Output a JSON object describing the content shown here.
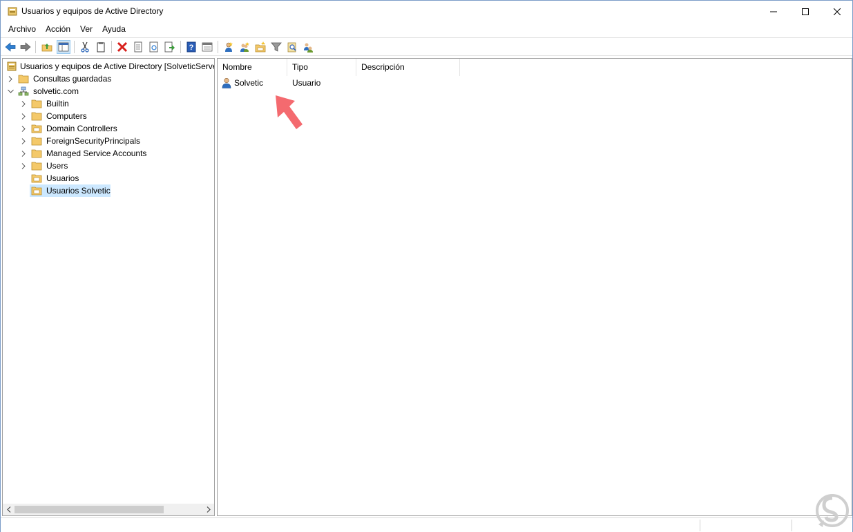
{
  "window": {
    "title": "Usuarios y equipos de Active Directory"
  },
  "menu": {
    "items": [
      "Archivo",
      "Acción",
      "Ver",
      "Ayuda"
    ]
  },
  "toolbar": {
    "icons": [
      "back-icon",
      "forward-icon",
      "up-folder-icon",
      "show-hide-console-tree-icon",
      "cut-icon",
      "copy-icon",
      "delete-icon",
      "properties-icon",
      "refresh-icon",
      "export-list-icon",
      "help-icon",
      "console-tree-icon",
      "new-user-icon",
      "new-group-icon",
      "new-ou-icon",
      "filter-icon",
      "find-icon",
      "add-to-group-icon"
    ]
  },
  "tree": {
    "root_label": "Usuarios y equipos de Active Directory [SolveticServer",
    "saved_queries": "Consultas guardadas",
    "domain": "solvetic.com",
    "children": [
      {
        "label": "Builtin",
        "icon": "folder-icon",
        "expandable": true
      },
      {
        "label": "Computers",
        "icon": "folder-icon",
        "expandable": true
      },
      {
        "label": "Domain Controllers",
        "icon": "ou-icon",
        "expandable": true
      },
      {
        "label": "ForeignSecurityPrincipals",
        "icon": "folder-icon",
        "expandable": true
      },
      {
        "label": "Managed Service Accounts",
        "icon": "folder-icon",
        "expandable": true
      },
      {
        "label": "Users",
        "icon": "folder-icon",
        "expandable": true
      },
      {
        "label": "Usuarios",
        "icon": "ou-icon",
        "expandable": false
      },
      {
        "label": "Usuarios Solvetic",
        "icon": "ou-icon",
        "expandable": false,
        "selected": true
      }
    ]
  },
  "list": {
    "columns": [
      "Nombre",
      "Tipo",
      "Descripción"
    ],
    "rows": [
      {
        "name": "Solvetic",
        "type": "Usuario",
        "description": ""
      }
    ]
  },
  "colors": {
    "selection": "#cce8ff",
    "annotation_arrow": "#f46a6f",
    "folder": "#f4c96a"
  }
}
